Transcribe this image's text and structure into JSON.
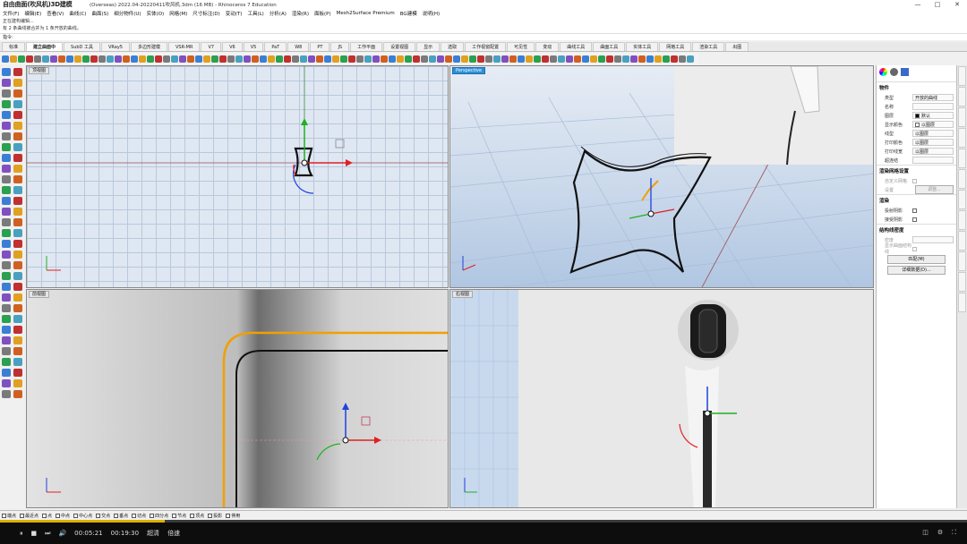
{
  "window": {
    "title": "(Overseas) 2022.04-20220411吹风机.3dm (16 MB) - Rhinoceros 7 Education",
    "overlay_text": "自由曲面(吹风机)3D建模",
    "controls": [
      "—",
      "□",
      "✕"
    ]
  },
  "menu": [
    "文件(F)",
    "编辑(E)",
    "查看(V)",
    "曲线(C)",
    "曲面(S)",
    "细分物件(U)",
    "实体(O)",
    "网格(M)",
    "尺寸标注(D)",
    "变动(T)",
    "工具(L)",
    "分析(A)",
    "渲染(R)",
    "面板(P)",
    "Mesh2Surface Premium",
    "BG建模",
    "说明(H)"
  ],
  "command_history": [
    "正在建构编辑...",
    "有 2 条曲线被合并为 1 条开放的曲线。"
  ],
  "command_prompt": "指令:",
  "tabs": [
    "标准",
    "建立曲面中",
    "SubD 工具",
    "VRay5",
    "多边形建模",
    "VSR-MR",
    "V7",
    "V6",
    "V5",
    "PaT",
    "W8",
    "PT",
    "JS",
    "工作平面",
    "设置视图",
    "显示",
    "选取",
    "工作视窗配置",
    "可见性",
    "变动",
    "曲线工具",
    "曲面工具",
    "实体工具",
    "网格工具",
    "渲染工具",
    "出图"
  ],
  "active_tab": "建立曲面中",
  "viewports": {
    "top": {
      "label": "顶视图"
    },
    "perspective": {
      "label": "Perspective"
    },
    "front": {
      "label": "前视图"
    },
    "right": {
      "label": "右视图"
    }
  },
  "properties": {
    "header": "物件",
    "rows": [
      {
        "key": "类型",
        "value": "开放的曲线"
      },
      {
        "key": "名称",
        "value": ""
      },
      {
        "key": "图层",
        "value": "默认"
      },
      {
        "key": "显示颜色",
        "value": "以图层"
      },
      {
        "key": "线型",
        "value": "以图层"
      },
      {
        "key": "打印颜色",
        "value": "以图层"
      },
      {
        "key": "打印线宽",
        "value": "以图层"
      },
      {
        "key": "超连结",
        "value": ""
      }
    ],
    "render_mesh_title": "渲染网格设置",
    "custom_mesh": "自定义网格",
    "settings_label": "设置",
    "adjust_button": "调整...",
    "render_title": "渲染",
    "cast_shadows": "投射阴影",
    "receive_shadows": "接受阴影",
    "structure_title": "结构线密度",
    "density_label": "密度",
    "show_iso": "显示曲面结构线",
    "match_button": "匹配(M)",
    "details_button": "详细数据(D)..."
  },
  "snaps": [
    "端点",
    "最近点",
    "点",
    "中点",
    "中心点",
    "交点",
    "垂点",
    "切点",
    "四分点",
    "节点",
    "顶点",
    "投影",
    "停用"
  ],
  "video": {
    "current_time": "00:05:21",
    "total_time": "00:19:30",
    "quality": "超清",
    "speed": "倍速",
    "progress": 0.17
  },
  "colors": {
    "x_axis": "#e02020",
    "y_axis": "#20b020",
    "z_axis": "#2040e0",
    "highlight_curve": "#f0a000",
    "active_viewport": "#2e8fd7"
  }
}
